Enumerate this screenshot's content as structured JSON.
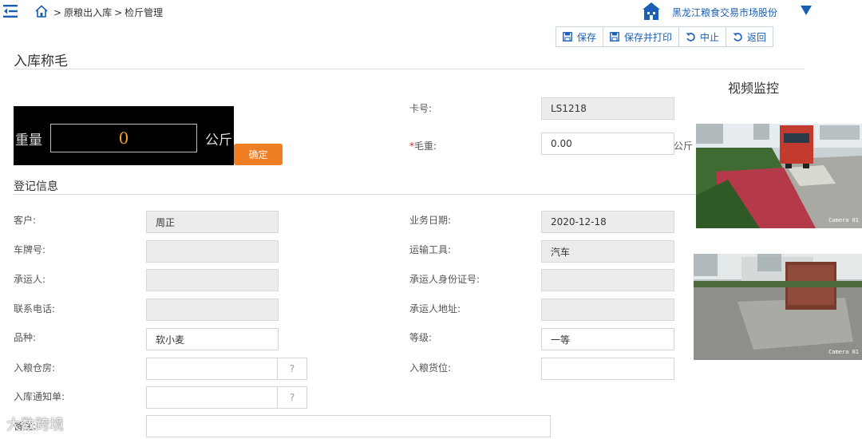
{
  "header": {
    "breadcrumb": [
      "原粮出入库",
      "检斤管理"
    ],
    "breadcrumb_sep": ">",
    "org_name": "黑龙江粮食交易市场股份"
  },
  "toolbar": {
    "save_label": "保存",
    "save_print_label": "保存并打印",
    "abort_label": "中止",
    "back_label": "返回"
  },
  "page": {
    "title": "入库称毛",
    "video_title": "视频监控"
  },
  "scale": {
    "weight_label": "重量",
    "value": "0",
    "unit": "公斤",
    "confirm_label": "确定"
  },
  "weigh": {
    "card_label": "卡号:",
    "card_value": "LS1218",
    "required_mark": "*",
    "gross_label": "毛重:",
    "gross_value": "0.00",
    "gross_unit": "公斤"
  },
  "register": {
    "section_title": "登记信息",
    "customer_label": "客户:",
    "customer_value": "周正",
    "biz_date_label": "业务日期:",
    "biz_date_value": "2020-12-18",
    "plate_label": "车牌号:",
    "plate_value": "",
    "transport_label": "运输工具:",
    "transport_value": "汽车",
    "carrier_label": "承运人:",
    "carrier_value": "",
    "carrier_id_label": "承运人身份证号:",
    "carrier_id_value": "",
    "phone_label": "联系电话:",
    "phone_value": "",
    "carrier_addr_label": "承运人地址:",
    "carrier_addr_value": "",
    "variety_label": "品种:",
    "variety_value": "软小麦",
    "grade_label": "等级:",
    "grade_value": "一等",
    "warehouse_label": "入粮仓房:",
    "warehouse_value": "",
    "warehouse_help": "?",
    "slot_label": "入粮货位:",
    "slot_value": "",
    "notice_label": "入库通知单:",
    "notice_value": "",
    "notice_help": "?",
    "remark_label": "备注:",
    "remark_value": ""
  },
  "cameras": [
    {
      "tag": "Camera 01"
    },
    {
      "tag": "Camera 01"
    }
  ],
  "watermark": "大数跨境",
  "colors": {
    "accent": "#1a5fb4",
    "confirm": "#f07f24",
    "scale_digits": "#f0a030",
    "required": "#e02020"
  }
}
